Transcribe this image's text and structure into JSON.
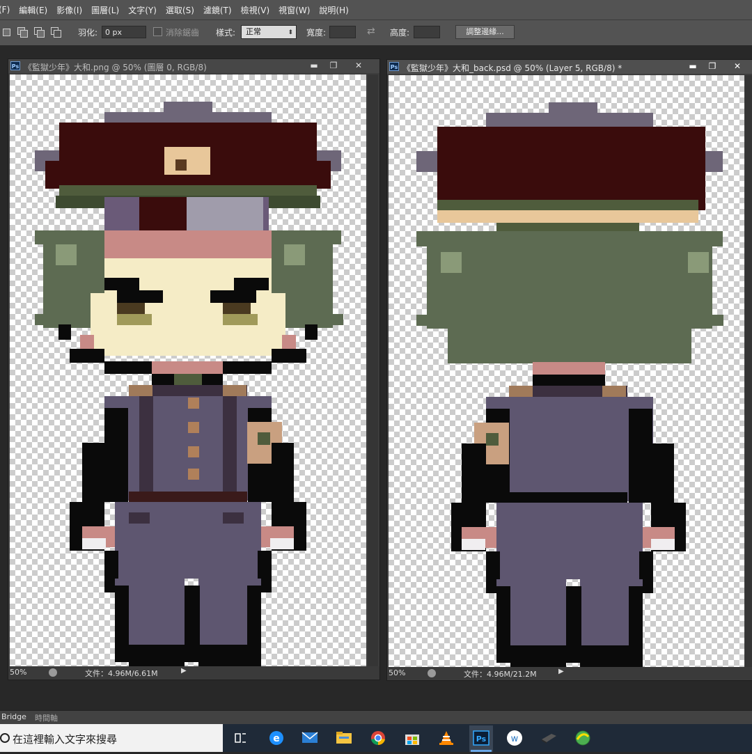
{
  "menu": [
    "(F)",
    "編輯(E)",
    "影像(I)",
    "圖層(L)",
    "文字(Y)",
    "選取(S)",
    "濾鏡(T)",
    "檢視(V)",
    "視窗(W)",
    "說明(H)"
  ],
  "options": {
    "feather_label": "羽化:",
    "feather_value": "0 px",
    "antialias_label": "消除鋸齒",
    "style_label": "樣式:",
    "style_value": "正常",
    "width_label": "寬度:",
    "height_label": "高度:",
    "refine_button": "調整邊緣..."
  },
  "documents": [
    {
      "title": "《監獄少年》大和.png @ 50% (圖層 0, RGB/8)",
      "zoom": "50%",
      "file_info": "文件：4.96M/6.61M"
    },
    {
      "title": "《監獄少年》大和_back.psd @ 50% (Layer 5, RGB/8) *",
      "zoom": "50%",
      "file_info": "文件：4.96M/21.2M"
    }
  ],
  "window_buttons": {
    "minimize": "▬",
    "restore": "❐",
    "close": "✕"
  },
  "panel_tabs": [
    "Bridge",
    "時間軸"
  ],
  "taskbar": {
    "search_placeholder": "在這裡輸入文字來搜尋",
    "icons": [
      "task-view",
      "edge",
      "mail",
      "file-explorer",
      "chrome",
      "store",
      "vlc",
      "photoshop",
      "wps",
      "app-dark",
      "app-green"
    ]
  },
  "colors": {
    "hat_brim": "#6e6678",
    "hat": "#3a0c0c",
    "hair": "#5d6b52",
    "hair_light": "#8a9a78",
    "skin": "#f5ecc6",
    "blush": "#c88a86",
    "uniform": "#5e5670",
    "uniform_dark": "#3c3040",
    "outline": "#0a0a0a",
    "band": "#4f5c3c",
    "gold": "#e8c79a",
    "ps_blue": "#31a8ff"
  }
}
